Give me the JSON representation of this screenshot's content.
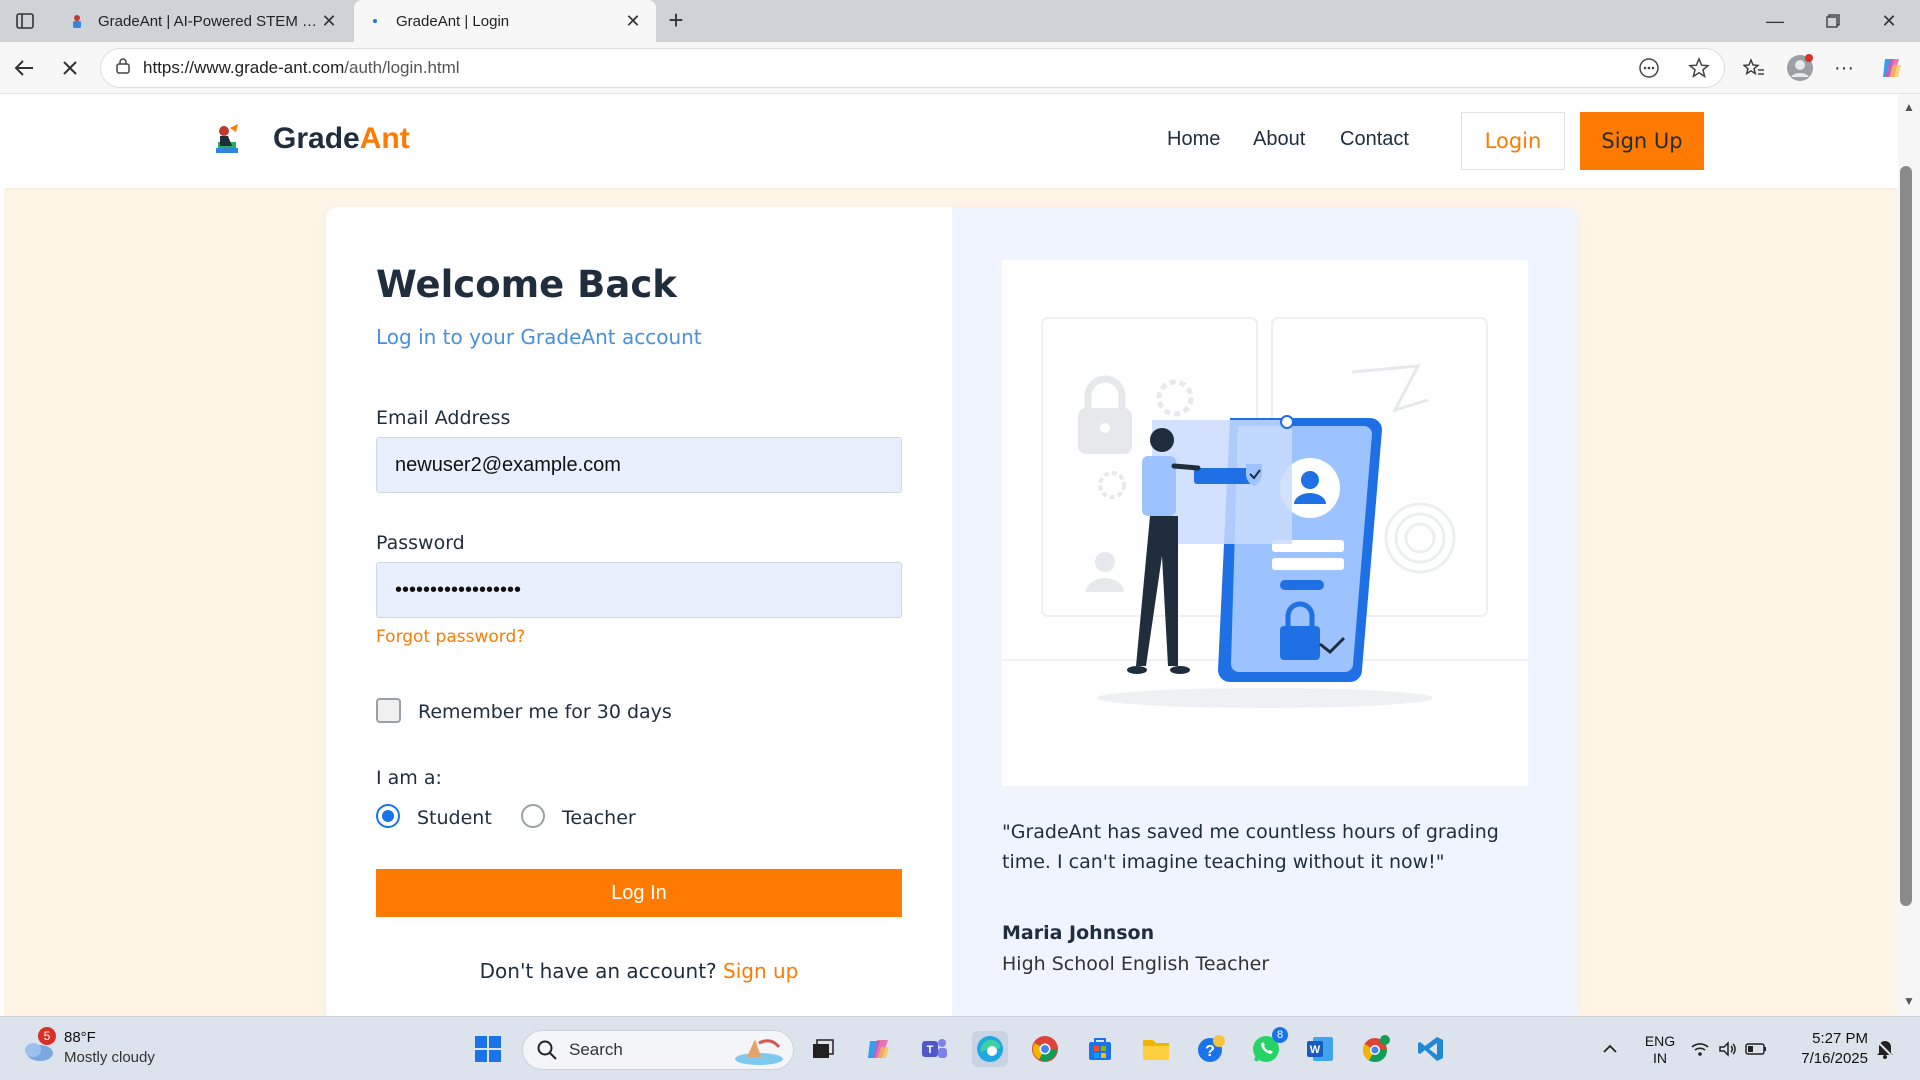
{
  "browser": {
    "tabs": [
      {
        "title": "GradeAnt | AI-Powered STEM Hom",
        "active": false
      },
      {
        "title": "GradeAnt | Login",
        "active": true
      }
    ],
    "url_host": "https://www.grade-ant.com",
    "url_path": "/auth/login.html"
  },
  "header": {
    "brand_a": "Grade",
    "brand_b": "Ant",
    "nav": [
      "Home",
      "About",
      "Contact"
    ],
    "login_label": "Login",
    "signup_label": "Sign Up"
  },
  "form": {
    "title": "Welcome Back",
    "subtitle": "Log in to your GradeAnt account",
    "email_label": "Email Address",
    "email_value": "newuser2@example.com",
    "password_label": "Password",
    "password_value": "••••••••••••••••••",
    "forgot_label": "Forgot password?",
    "remember_label": "Remember me for 30 days",
    "remember_checked": false,
    "role_label": "I am a:",
    "roles": [
      {
        "label": "Student",
        "selected": true
      },
      {
        "label": "Teacher",
        "selected": false
      }
    ],
    "submit_label": "Log In",
    "signup_prompt": "Don't have an account?",
    "signup_link": "Sign up"
  },
  "testimonial": {
    "quote": "\"GradeAnt has saved me countless hours of grading time. I can't imagine teaching without it now!\"",
    "author": "Maria Johnson",
    "role": "High School English Teacher"
  },
  "taskbar": {
    "weather_temp": "88°F",
    "weather_cond": "Mostly cloudy",
    "weather_badge": "5",
    "search_label": "Search",
    "lang_line1": "ENG",
    "lang_line2": "IN",
    "time": "5:27 PM",
    "date": "7/16/2025",
    "whatsapp_badge": "8"
  },
  "colors": {
    "accent": "#ff7a00",
    "link_blue": "#4a8fe0",
    "page_bg": "#fff5e6",
    "panel_bg": "#eff4ff",
    "input_bg": "#e8f0fe"
  }
}
